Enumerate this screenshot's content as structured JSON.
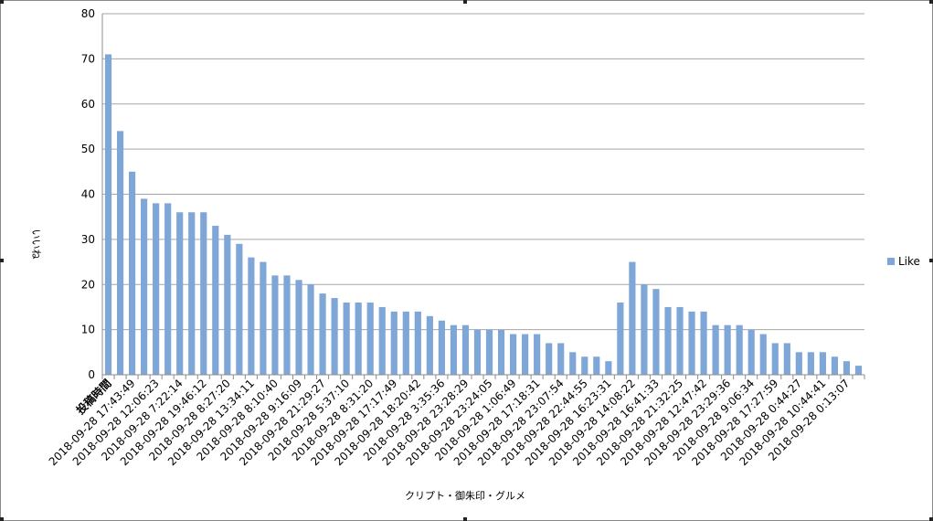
{
  "chart_data": {
    "type": "bar",
    "xlabel": "クリプト・御朱印・グルメ",
    "ylabel": "いいね",
    "ylim": [
      0,
      80
    ],
    "yticks": [
      0,
      10,
      20,
      30,
      40,
      50,
      60,
      70,
      80
    ],
    "grid": true,
    "legend_position": "right",
    "series": [
      {
        "name": "Like",
        "color": "#7ea6d6",
        "values": [
          71,
          54,
          45,
          39,
          38,
          38,
          36,
          36,
          36,
          33,
          31,
          29,
          26,
          25,
          22,
          22,
          21,
          20,
          18,
          17,
          16,
          16,
          16,
          15,
          14,
          14,
          14,
          13,
          12,
          11,
          11,
          10,
          10,
          10,
          9,
          9,
          9,
          7,
          7,
          5,
          4,
          4,
          3,
          16,
          25,
          20,
          19,
          15,
          15,
          14,
          14,
          11,
          11,
          11,
          10,
          9,
          7,
          7,
          5,
          5,
          5,
          4,
          3,
          2
        ]
      }
    ],
    "tick_labels": [
      "投稿時間",
      "2018-09-28 17:43:49",
      "2018-09-28 12:06:23",
      "2018-09-28 7:22:14",
      "2018-09-28 19:46:12",
      "2018-09-28 8:27:20",
      "2018-09-28 13:34:11",
      "2018-09-28 8:10:40",
      "2018-09-28 9:16:09",
      "2018-09-28 21:29:27",
      "2018-09-28 5:37:10",
      "2018-09-28 8:31:20",
      "2018-09-28 17:17:49",
      "2018-09-28 18:20:42",
      "2018-09-28 3:35:36",
      "2018-09-28 23:28:29",
      "2018-09-28 23:24:05",
      "2018-09-28 1:06:49",
      "2018-09-28 17:18:31",
      "2018-09-28 23:07:54",
      "2018-09-28 22:44:55",
      "2018-09-28 16:23:31",
      "2018-09-28 14:08:22",
      "2018-09-28 16:41:33",
      "2018-09-28 21:32:25",
      "2018-09-28 12:47:42",
      "2018-09-28 23:29:36",
      "2018-09-28 9:06:34",
      "2018-09-28 17:27:59",
      "2018-09-28 0:44:27",
      "2018-09-28 10:44:41",
      "2018-09-28 0:13:07"
    ]
  }
}
